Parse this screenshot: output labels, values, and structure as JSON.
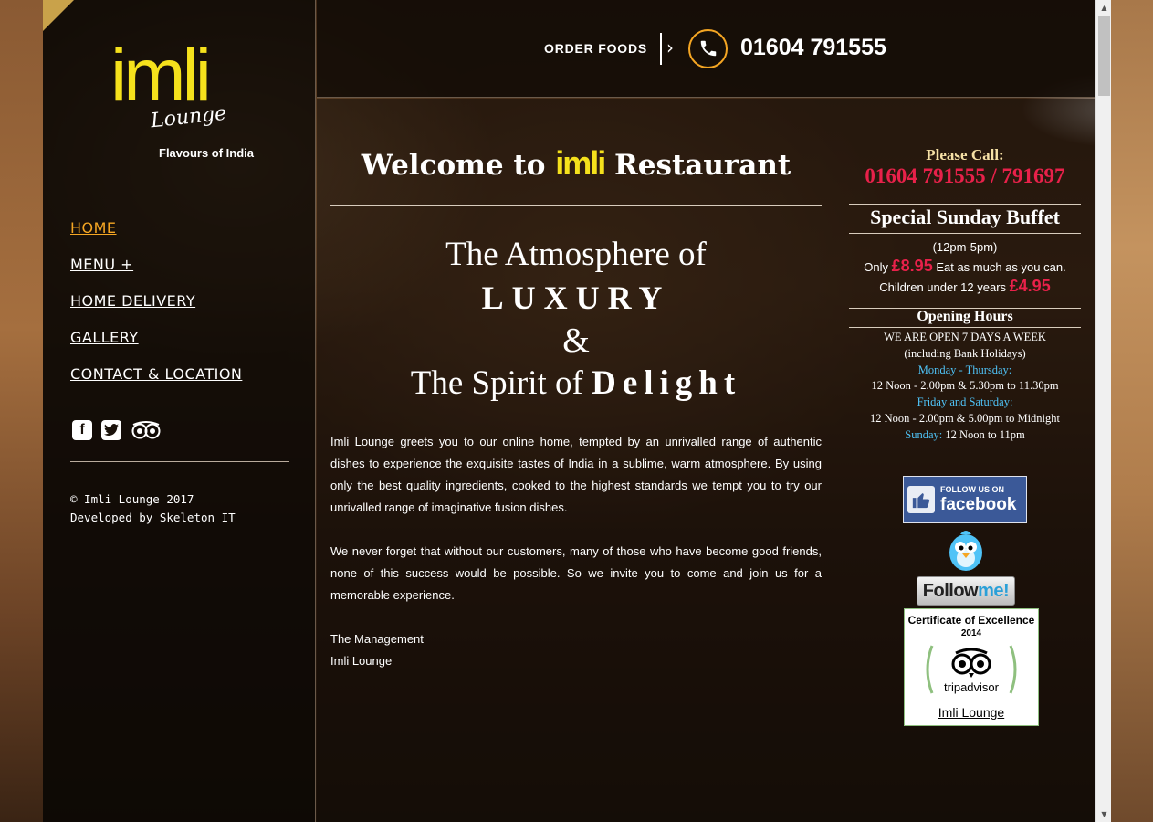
{
  "sidebar": {
    "logo": {
      "wordmark": "imli",
      "sub": "Lounge",
      "tagline": "Flavours of India"
    },
    "nav": [
      {
        "label": "HOME",
        "active": true
      },
      {
        "label": "MENU +",
        "active": false
      },
      {
        "label": "HOME DELIVERY",
        "active": false
      },
      {
        "label": "GALLERY",
        "active": false
      },
      {
        "label": "CONTACT & LOCATION",
        "active": false
      }
    ],
    "social_icons": [
      "facebook-icon",
      "twitter-icon",
      "tripadvisor-icon"
    ],
    "credits": {
      "copyright": "© Imli Lounge 2017",
      "developer": "Developed by Skeleton IT"
    }
  },
  "header": {
    "order_label": "ORDER FOODS",
    "phone": "01604 791555",
    "icons": [
      "chevron-right-icon",
      "phone-icon"
    ]
  },
  "main": {
    "welcome": {
      "prefix": "Welcome to",
      "brand": "imli",
      "suffix": "Restaurant"
    },
    "slogan": {
      "line1": "The Atmosphere of",
      "line2": "LUXURY",
      "line3": "&",
      "line4_prefix": "The Spirit of",
      "line4_emphasis": "Delight"
    },
    "paragraphs": [
      "Imli Lounge greets you to our online home, tempted by an unrivalled range of authentic dishes to experience the exquisite tastes of India in a sublime, warm atmosphere. By using only the best quality ingredients, cooked to the highest standards we tempt you to try our unrivalled range of imaginative fusion dishes.",
      "We never forget that without our customers, many of those who have become good friends, none of this success would be possible. So we invite you to come and join us for a memorable experience."
    ],
    "signoff": {
      "line1": "The Management",
      "line2": "Imli Lounge"
    }
  },
  "right": {
    "please_call": "Please Call:",
    "phones": "01604 791555 / 791697",
    "buffet": {
      "title": "Special Sunday Buffet",
      "time": "(12pm-5pm)",
      "only": "Only",
      "price_adult": "£8.95",
      "eat_text": "Eat as much as you can.",
      "children_text": "Children under 12 years",
      "price_child": "£4.95"
    },
    "hours": {
      "title": "Opening Hours",
      "open": "WE ARE OPEN 7 DAYS A WEEK",
      "bank": "(including Bank Holidays)",
      "mon_thu_label": "Monday - Thursday:",
      "mon_thu": "12 Noon - 2.00pm & 5.30pm to 11.30pm",
      "fri_sat_label": "Friday and Saturday:",
      "fri_sat": "12 Noon - 2.00pm & 5.00pm to Midnight",
      "sun_label": "Sunday:",
      "sun": "12 Noon to 11pm"
    },
    "badges": {
      "facebook_small": "FOLLOW US ON",
      "facebook_big": "facebook",
      "twitter_follow": "Follow",
      "twitter_me": "me!",
      "tripadvisor_cert": "Certificate of Excellence",
      "tripadvisor_year": "2014",
      "tripadvisor_name": "tripadvisor",
      "tripadvisor_link": "Imli Lounge"
    }
  },
  "colors": {
    "accent_orange": "#f5a623",
    "brand_yellow": "#f5e11c",
    "price_red": "#e8214a",
    "hours_blue": "#4fc3f7"
  }
}
